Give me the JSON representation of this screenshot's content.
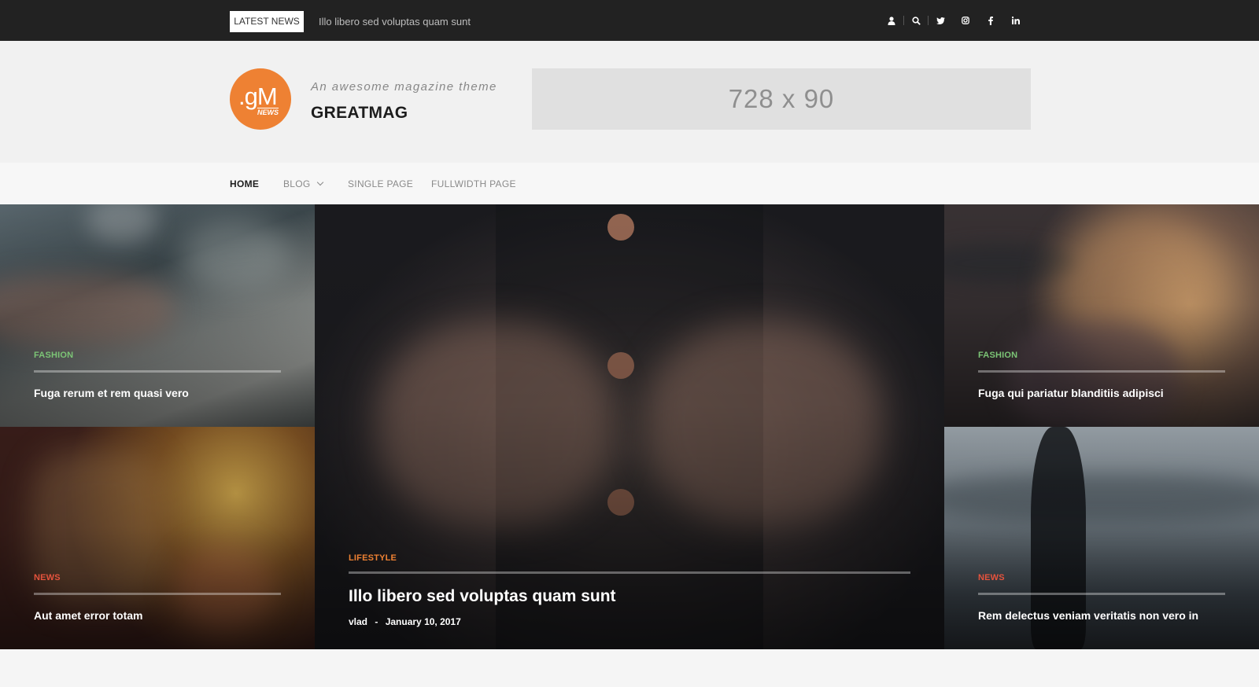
{
  "topbar": {
    "latest_label": "LATEST NEWS",
    "ticker": "Illo libero sed voluptas quam sunt",
    "icons": [
      "user-icon",
      "search-icon",
      "twitter-icon",
      "instagram-icon",
      "facebook-icon",
      "linkedin-icon"
    ]
  },
  "header": {
    "logo_text": ".gM",
    "logo_sub": "NEWS",
    "tagline": "An awesome magazine theme",
    "site_title": "GREATMAG",
    "ad_text": "728 x 90",
    "logo_color": "#ee8133"
  },
  "nav": {
    "items": [
      {
        "label": "HOME"
      },
      {
        "label": "BLOG"
      },
      {
        "label": "SINGLE PAGE"
      },
      {
        "label": "FULLWIDTH PAGE"
      }
    ]
  },
  "posts": [
    {
      "category": "FASHION",
      "title": "Fuga rerum et rem quasi vero",
      "cat_color": "#7cc576"
    },
    {
      "category": "NEWS",
      "title": "Aut amet error totam",
      "cat_color": "#e5533d"
    },
    {
      "category": "LIFESTYLE",
      "title": "Illo libero sed voluptas quam sunt",
      "author": "vlad",
      "sep": "-",
      "date": "January 10, 2017",
      "cat_color": "#ee8133"
    },
    {
      "category": "FASHION",
      "title": "Fuga qui pariatur blanditiis adipisci",
      "cat_color": "#7cc576"
    },
    {
      "category": "NEWS",
      "title": "Rem delectus veniam veritatis non vero in",
      "cat_color": "#e5533d"
    }
  ]
}
